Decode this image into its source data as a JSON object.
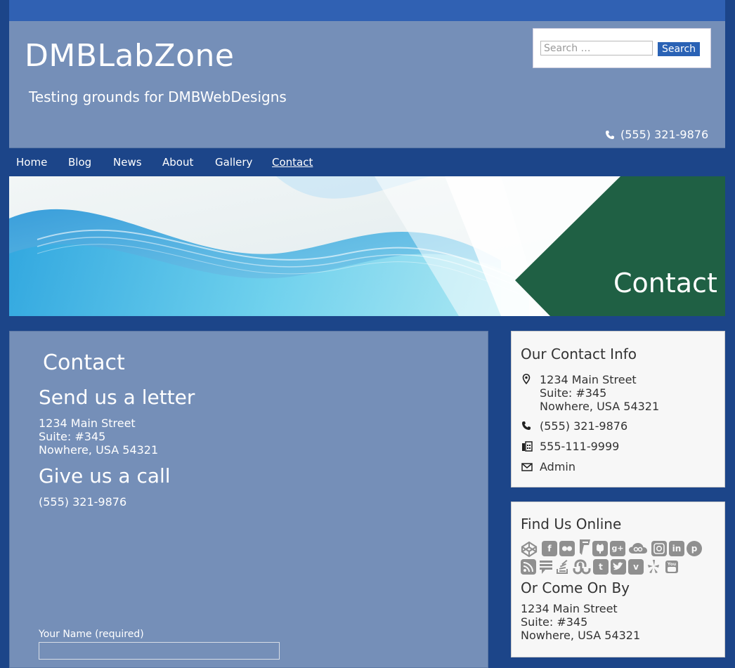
{
  "site": {
    "title": "DMBLabZone",
    "tagline": "Testing grounds for DMBWebDesigns",
    "phone": "(555) 321-9876"
  },
  "search": {
    "placeholder": "Search …",
    "button_label": "Search"
  },
  "nav": {
    "items": [
      {
        "label": "Home"
      },
      {
        "label": "Blog"
      },
      {
        "label": "News"
      },
      {
        "label": "About"
      },
      {
        "label": "Gallery"
      },
      {
        "label": "Contact",
        "active": true
      }
    ]
  },
  "banner": {
    "title": "Contact"
  },
  "main": {
    "heading": "Contact",
    "letter_heading": "Send us a letter",
    "address": [
      "1234 Main Street",
      "Suite: #345",
      "Nowhere, USA 54321"
    ],
    "call_heading": "Give us a call",
    "phone": "(555) 321-9876",
    "form": {
      "name_label": "Your Name (required)",
      "name_value": ""
    }
  },
  "sidebar": {
    "contact_info": {
      "title": "Our Contact Info",
      "address": [
        "1234 Main Street",
        "Suite: #345",
        "Nowhere, USA 54321"
      ],
      "phone": "(555) 321-9876",
      "fax": "555-111-9999",
      "email": "Admin"
    },
    "find_us": {
      "title": "Find Us Online",
      "icons": [
        "codepen-icon",
        "facebook-icon",
        "flickr-icon",
        "foursquare-icon",
        "github-icon",
        "google-plus-icon",
        "cloud-icon",
        "instagram-icon",
        "linkedin-icon",
        "pinterest-icon",
        "rss-icon",
        "comments-icon",
        "stackoverflow-icon",
        "stumbleupon-icon",
        "tumblr-icon",
        "twitter-icon",
        "vimeo-icon",
        "yelp-icon",
        "youtube-icon"
      ],
      "come_by_title": "Or Come On By",
      "address": [
        "1234 Main Street",
        "Suite: #345",
        "Nowhere, USA 54321"
      ]
    }
  },
  "colors": {
    "page_bg": "#1c4589",
    "header_bg": "#758fb8",
    "accent_blue": "#2a62b5",
    "banner_green": "#1f6044",
    "widget_bg": "#f7f7f7"
  }
}
